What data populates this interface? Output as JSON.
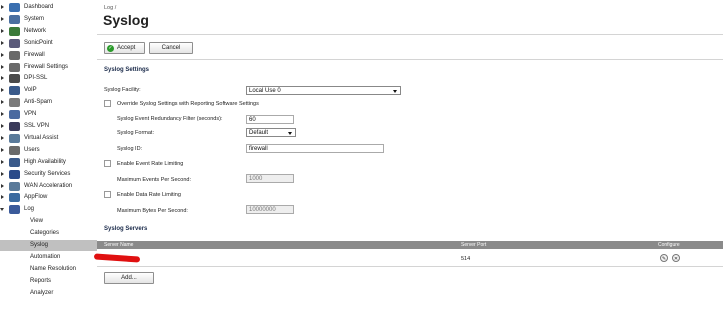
{
  "sidebar": {
    "items": [
      {
        "label": "Dashboard",
        "icon": "dashboard-icon",
        "color": "#3a6fb0"
      },
      {
        "label": "System",
        "icon": "monitor-icon",
        "color": "#4a6fa0"
      },
      {
        "label": "Network",
        "icon": "globe-icon",
        "color": "#3a7a3a"
      },
      {
        "label": "SonicPoint",
        "icon": "access-point-icon",
        "color": "#5a5a7a"
      },
      {
        "label": "Firewall",
        "icon": "firewall-icon",
        "color": "#6a6a6a"
      },
      {
        "label": "Firewall Settings",
        "icon": "firewall-settings-icon",
        "color": "#6a6a6a"
      },
      {
        "label": "DPI-SSL",
        "icon": "dpi-ssl-icon",
        "color": "#4a4a4a"
      },
      {
        "label": "VoIP",
        "icon": "voip-icon",
        "color": "#3a5a8a"
      },
      {
        "label": "Anti-Spam",
        "icon": "anti-spam-icon",
        "color": "#7a7a7a"
      },
      {
        "label": "VPN",
        "icon": "vpn-icon",
        "color": "#4a6aa0"
      },
      {
        "label": "SSL VPN",
        "icon": "ssl-vpn-icon",
        "color": "#3a3a5a"
      },
      {
        "label": "Virtual Assist",
        "icon": "virtual-assist-icon",
        "color": "#5a7a9a"
      },
      {
        "label": "Users",
        "icon": "users-icon",
        "color": "#6a6a6a"
      },
      {
        "label": "High Availability",
        "icon": "high-availability-icon",
        "color": "#3a5a8a"
      },
      {
        "label": "Security Services",
        "icon": "shield-icon",
        "color": "#2a4a8a"
      },
      {
        "label": "WAN Acceleration",
        "icon": "wan-acceleration-icon",
        "color": "#5a7a9a"
      },
      {
        "label": "AppFlow",
        "icon": "appflow-icon",
        "color": "#3a6aa0"
      },
      {
        "label": "Log",
        "icon": "log-icon",
        "color": "#3a5a9a"
      }
    ],
    "log_children": [
      "View",
      "Categories",
      "Syslog",
      "Automation",
      "Name Resolution",
      "Reports",
      "Analyzer"
    ],
    "active": "Syslog"
  },
  "breadcrumb": "Log /",
  "title": "Syslog",
  "toolbar": {
    "accept_label": "Accept",
    "cancel_label": "Cancel",
    "accept_icon_color": "#2a9a2a"
  },
  "syslog_settings": {
    "header": "Syslog Settings",
    "facility_label": "Syslog Facility:",
    "facility_value": "Local Use 0",
    "override_label": "Override Syslog Settings with Reporting Software Settings",
    "redundancy_label": "Syslog Event Redundancy Filter (seconds):",
    "redundancy_value": "60",
    "format_label": "Syslog Format:",
    "format_value": "Default",
    "id_label": "Syslog ID:",
    "id_value": "firewall",
    "event_rate_label": "Enable Event Rate Limiting",
    "max_events_label": "Maximum Events Per Second:",
    "max_events_value": "1000",
    "data_rate_label": "Enable Data Rate Limiting",
    "max_bytes_label": "Maximum Bytes Per Second:",
    "max_bytes_value": "10000000"
  },
  "syslog_servers": {
    "header": "Syslog Servers",
    "columns": {
      "name": "Server Name",
      "port": "Server Port",
      "configure": "Configure"
    },
    "rows": [
      {
        "name": "",
        "port": "514"
      }
    ],
    "add_label": "Add..."
  },
  "colors": {
    "redaction": "#e01010",
    "table_header": "#8a8a8a",
    "active_nav": "#c0c0c0"
  }
}
